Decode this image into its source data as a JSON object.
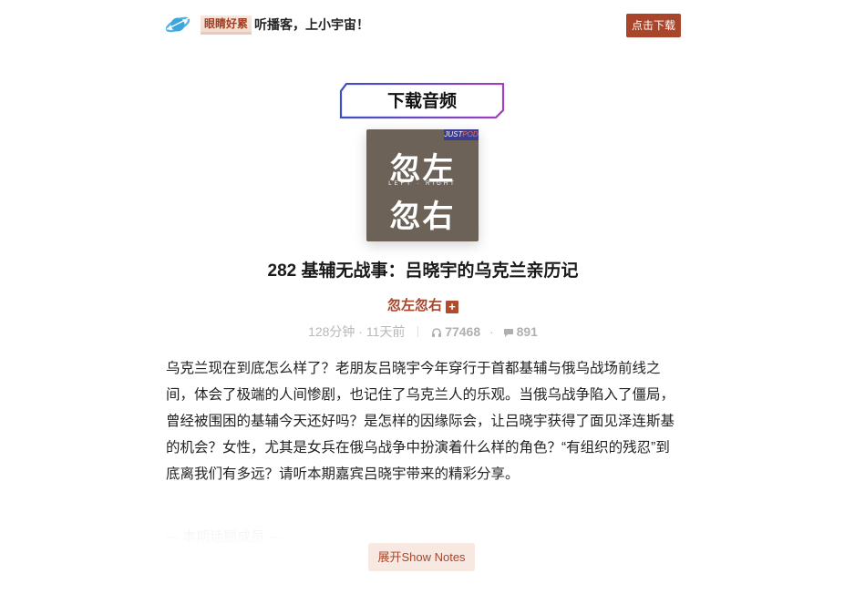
{
  "topbar": {
    "logo_icon": "planet-icon",
    "tag": "眼睛好累",
    "slogan": "听播客，上小宇宙！",
    "download_label": "点击下载"
  },
  "badge": {
    "label": "下载音频"
  },
  "cover": {
    "corner_tag_a": "JUST",
    "corner_tag_b": "POD",
    "line1": "忽左",
    "sub": "LEFT · RIGHT",
    "line2": "忽右"
  },
  "episode": {
    "title": "282 基辅无战事：吕晓宇的乌克兰亲历记",
    "podcast": "忽左忽右",
    "follow_icon": "plus-icon",
    "duration_age": "128分钟 · 11天前",
    "plays": "77468",
    "plays_icon": "headphones-icon",
    "dot": "·",
    "comments": "891",
    "comments_icon": "comment-icon",
    "description": "乌克兰现在到底怎么样了？老朋友吕晓宇今年穿行于首都基辅与俄乌战场前线之间，体会了极端的人间惨剧，也记住了乌克兰人的乐观。当俄乌战争陷入了僵局，曾经被围困的基辅今天还好吗？是怎样的因缘际会，让吕晓宇获得了面见泽连斯基的机会？女性，尤其是女兵在俄乌战争中扮演着什么样的角色？“有组织的残忍”到底离我们有多远？请听本期嘉宾吕晓宇带来的精彩分享。",
    "section_heading": "— 本期话题成员 —",
    "expand_label": "展开Show Notes"
  },
  "colors": {
    "accent": "#a8452a",
    "badge_gradient_start": "#3a4fc4",
    "badge_gradient_end": "#a040c0"
  }
}
